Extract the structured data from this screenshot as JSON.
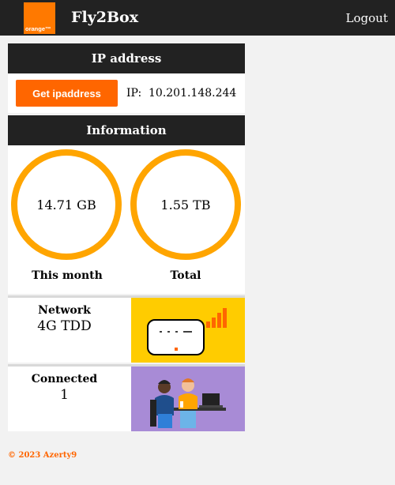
{
  "header": {
    "logo_text": "orange™",
    "brand": "Fly2Box",
    "logout_label": "Logout"
  },
  "ip_card": {
    "title": "IP address",
    "button_label": "Get ipaddress",
    "ip_label": "IP:",
    "ip_value": "10.201.148.244"
  },
  "info_card": {
    "title": "Information",
    "gauges": [
      {
        "value": "14.71 GB",
        "label": "This month"
      },
      {
        "value": "1.55 TB",
        "label": "Total"
      }
    ]
  },
  "network": {
    "title": "Network",
    "value": "4G TDD"
  },
  "connected": {
    "title": "Connected",
    "value": "1"
  },
  "footer": {
    "text": "© 2023 Azerty9"
  },
  "colors": {
    "brand_orange": "#ff7900",
    "button_orange": "#ff6600",
    "gauge_ring": "#ffa500",
    "header_dark": "#222222",
    "network_bg": "#ffcc00",
    "connected_bg": "#a88bd6"
  },
  "icons": [
    "orange-logo",
    "router-icon",
    "signal-bars-icon",
    "people-laptop-illustration"
  ]
}
